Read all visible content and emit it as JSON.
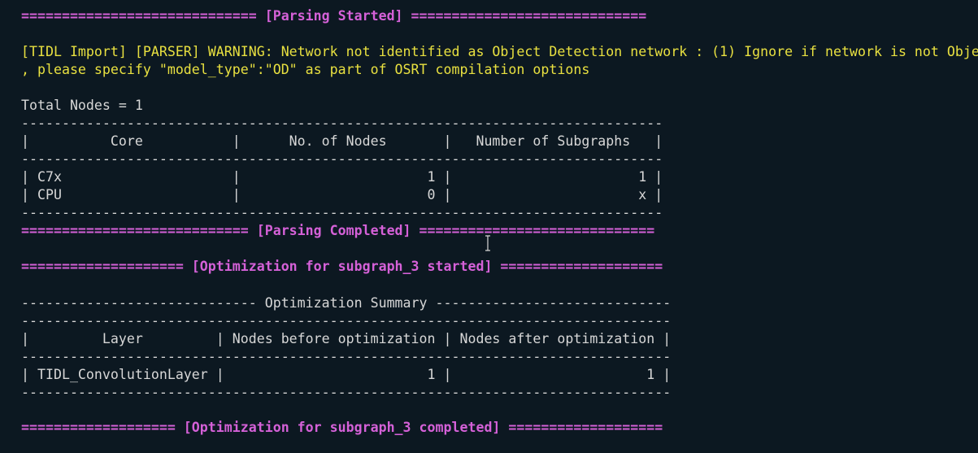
{
  "terminal": {
    "colors": {
      "background": "#0c1821",
      "text": "#d7d7d7",
      "header": "#d561d8",
      "warning": "#e8e040"
    },
    "lines": [
      "============================= [Parsing Started] =============================",
      "",
      "[TIDL Import] [PARSER] WARNING: Network not identified as Object Detection network : (1) Ignore if network is not Obje",
      ", please specify \"model_type\":\"OD\" as part of OSRT compilation options",
      "",
      "Total Nodes = 1",
      "-------------------------------------------------------------------------------",
      "|          Core           |      No. of Nodes       |   Number of Subgraphs   |",
      "-------------------------------------------------------------------------------",
      "| C7x                     |                       1 |                       1 |",
      "| CPU                     |                       0 |                       x |",
      "-------------------------------------------------------------------------------",
      "============================ [Parsing Completed] =============================",
      "",
      "==================== [Optimization for subgraph_3 started] ====================",
      "",
      "----------------------------- Optimization Summary -----------------------------",
      "--------------------------------------------------------------------------------",
      "|         Layer         | Nodes before optimization | Nodes after optimization |",
      "--------------------------------------------------------------------------------",
      "| TIDL_ConvolutionLayer |                         1 |                        1 |",
      "--------------------------------------------------------------------------------",
      "",
      "=================== [Optimization for subgraph_3 completed] ==================="
    ]
  },
  "cursor": {
    "icon": "i-beam-cursor-icon"
  }
}
